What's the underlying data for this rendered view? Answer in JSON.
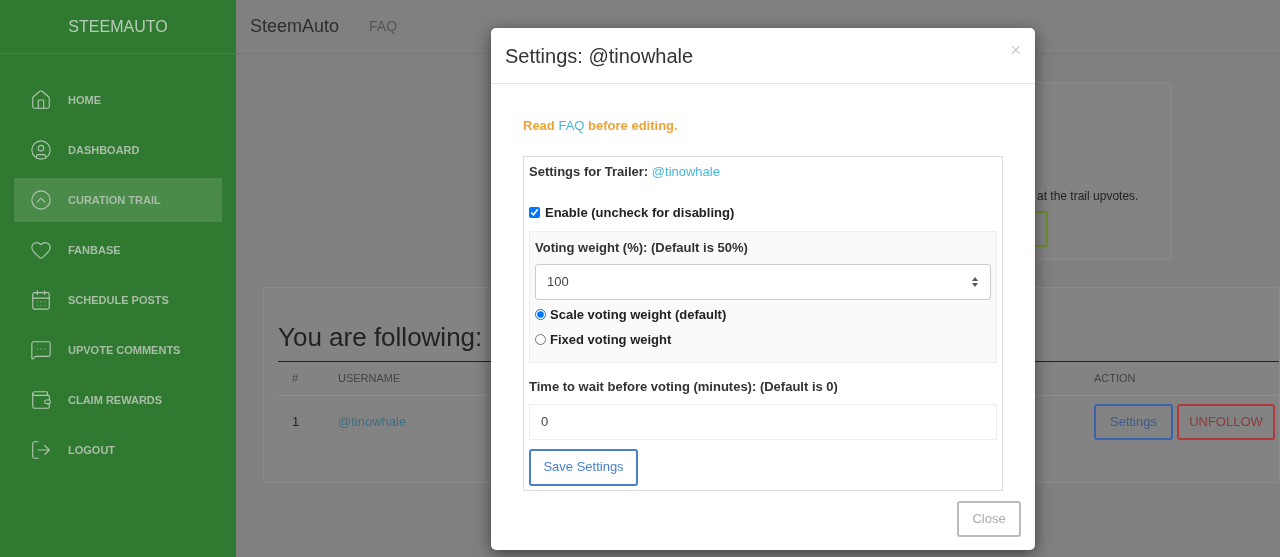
{
  "sidebar": {
    "brand": "STEEMAUTO",
    "items": [
      {
        "kind": "home",
        "label": "HOME",
        "selected": false
      },
      {
        "kind": "dashboard",
        "label": "DASHBOARD",
        "selected": false
      },
      {
        "kind": "trail",
        "label": "CURATION TRAIL",
        "selected": true
      },
      {
        "kind": "fanbase",
        "label": "FANBASE",
        "selected": false
      },
      {
        "kind": "schedule",
        "label": "SCHEDULE POSTS",
        "selected": false
      },
      {
        "kind": "comments",
        "label": "UPVOTE COMMENTS",
        "selected": false
      },
      {
        "kind": "rewards",
        "label": "CLAIM REWARDS",
        "selected": false
      },
      {
        "kind": "logout",
        "label": "LOGOUT",
        "selected": false
      }
    ]
  },
  "navbar": {
    "brand": "SteemAuto",
    "links": [
      "FAQ"
    ]
  },
  "info_card": {
    "text": "at the trail upvotes."
  },
  "following": {
    "title": "You are following:",
    "columns": [
      "#",
      "USERNAME",
      "ACTION"
    ],
    "rows": [
      {
        "index": "1",
        "username": "@tinowhale",
        "actions": [
          "Settings",
          "UNFOLLOW"
        ]
      }
    ]
  },
  "modal": {
    "title": "Settings: @tinowhale",
    "close_icon": "×",
    "notice": {
      "before": "Read",
      "link": "FAQ",
      "after": "before editing."
    },
    "trailer_label": "Settings for Trailer:",
    "trailer": "@tinowhale",
    "enable": {
      "label": "Enable (uncheck for disabling)",
      "checked": true
    },
    "weight_label": "Voting weight (%): (Default is 50%)",
    "weight_value": "100",
    "modes": [
      {
        "label": "Scale voting weight (default)",
        "selected": true
      },
      {
        "label": "Fixed voting weight",
        "selected": false
      }
    ],
    "wait_label": "Time to wait before voting (minutes): (Default is 0)",
    "wait_value": "0",
    "save": "Save Settings",
    "close": "Close"
  }
}
